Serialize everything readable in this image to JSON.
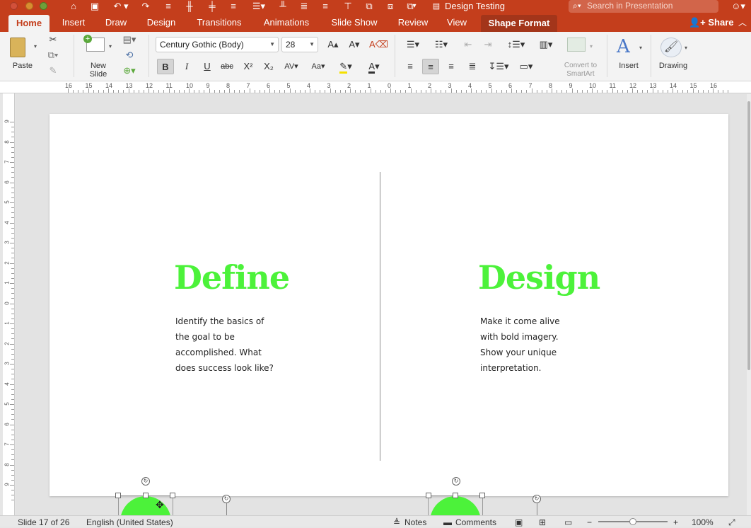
{
  "window": {
    "title": "Design Testing",
    "search_placeholder": "Search in Presentation",
    "share_label": "Share"
  },
  "tabs": [
    {
      "label": "Home"
    },
    {
      "label": "Insert"
    },
    {
      "label": "Draw"
    },
    {
      "label": "Design"
    },
    {
      "label": "Transitions"
    },
    {
      "label": "Animations"
    },
    {
      "label": "Slide Show"
    },
    {
      "label": "Review"
    },
    {
      "label": "View"
    },
    {
      "label": "Shape Format"
    }
  ],
  "ribbon": {
    "paste_label": "Paste",
    "new_slide_label": "New Slide",
    "font_name": "Century Gothic (Body)",
    "font_size": "28",
    "convert_smartart_label": "Convert to SmartArt",
    "insert_label": "Insert",
    "drawing_label": "Drawing",
    "bold": "B",
    "italic": "I",
    "underline": "U",
    "strike": "abc"
  },
  "ruler": {
    "h_numbers": [
      "16",
      "15",
      "14",
      "13",
      "12",
      "11",
      "10",
      "9",
      "8",
      "7",
      "6",
      "5",
      "4",
      "3",
      "2",
      "1",
      "0",
      "1",
      "2",
      "3",
      "4",
      "5",
      "6",
      "7",
      "8",
      "9",
      "10",
      "11",
      "12",
      "13",
      "14",
      "15",
      "16"
    ],
    "v_numbers": [
      "9",
      "8",
      "7",
      "6",
      "5",
      "4",
      "3",
      "2",
      "1",
      "0",
      "1",
      "2",
      "3",
      "4",
      "5",
      "6",
      "7",
      "8",
      "9"
    ]
  },
  "slide": {
    "left": {
      "heading": "Define",
      "body": [
        "Identify the basics of",
        "the goal to be",
        "accomplished. What",
        "does success look like?"
      ]
    },
    "right": {
      "heading": "Design",
      "body": [
        "Make it come alive",
        "with bold imagery.",
        "Show your unique",
        "interpretation."
      ]
    },
    "accent_color": "#4cf23a"
  },
  "status": {
    "slide_info": "Slide 17 of 26",
    "language": "English (United States)",
    "notes_label": "Notes",
    "comments_label": "Comments",
    "zoom": "100%"
  }
}
